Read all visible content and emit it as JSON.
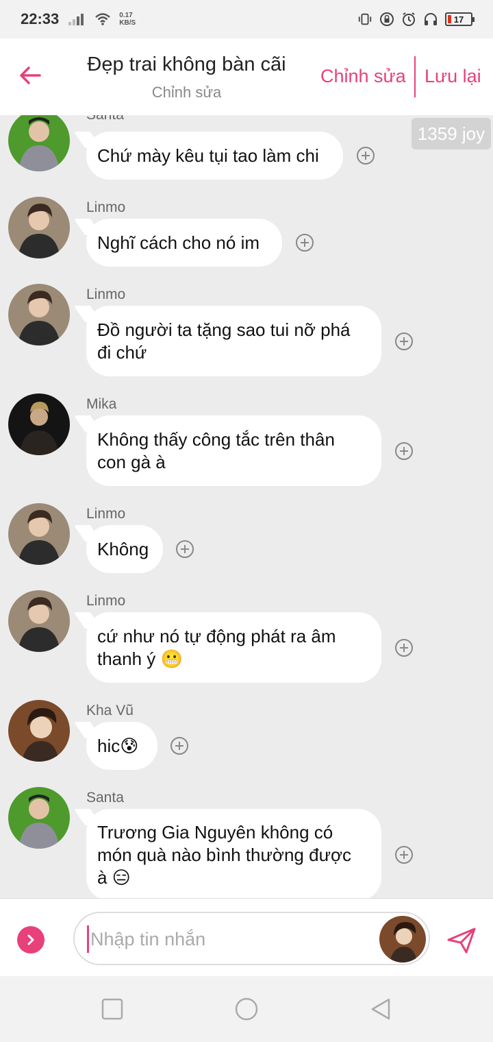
{
  "status_bar": {
    "time": "22:33",
    "net_speed_value": "0.17",
    "net_speed_unit": "KB/S",
    "battery": "17"
  },
  "header": {
    "title": "Đẹp trai không bàn cãi",
    "subtitle": "Chỉnh sửa",
    "edit_label": "Chỉnh sửa",
    "save_label": "Lưu lại",
    "accent": "#e8407b"
  },
  "joy_badge": "1359 joy",
  "messages": [
    {
      "sender": "Santa",
      "lines": [
        "Chứ mày kêu tụi tao làm chi"
      ]
    },
    {
      "sender": "Linmo",
      "lines": [
        "Nghĩ cách cho nó im"
      ]
    },
    {
      "sender": "Linmo",
      "lines": [
        "Đồ người ta tặng sao tui nỡ phá",
        "đi chứ"
      ]
    },
    {
      "sender": "Mika",
      "lines": [
        "Không thấy công tắc trên thân",
        "con gà à"
      ]
    },
    {
      "sender": "Linmo",
      "lines": [
        "Không"
      ]
    },
    {
      "sender": "Linmo",
      "lines": [
        "cứ như nó tự động phát ra âm",
        "thanh ý 😬"
      ]
    },
    {
      "sender": "Kha Vũ",
      "lines": [
        "hic😰"
      ]
    },
    {
      "sender": "Santa",
      "lines": [
        "Trương Gia Nguyên không có",
        "món quà nào bình thường được",
        "à 😑"
      ]
    }
  ],
  "input": {
    "placeholder": "Nhập tin nhắn"
  }
}
